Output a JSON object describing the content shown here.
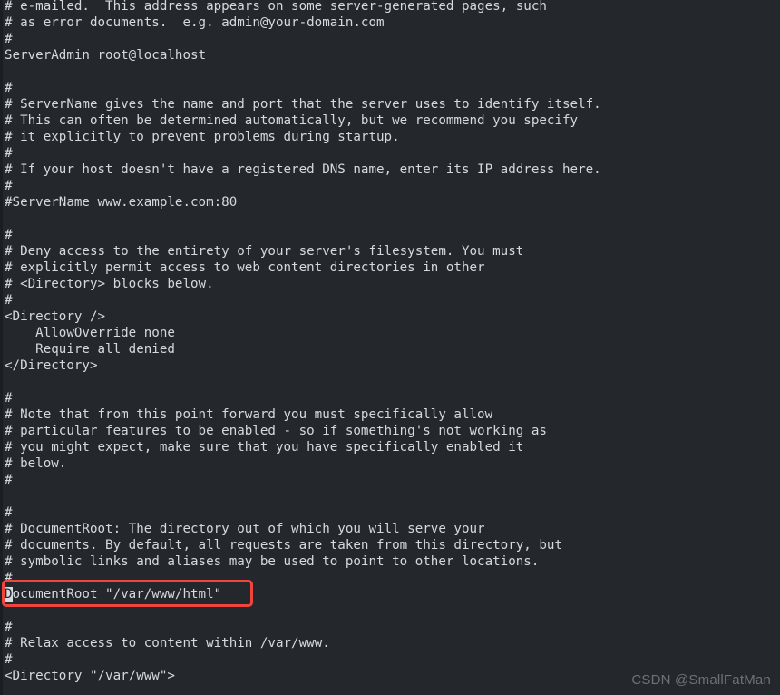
{
  "editor": {
    "background_color": "#24282c",
    "text_color": "#d6d9dc",
    "highlight_color": "#f0453c",
    "cursor_char": "D",
    "lines": [
      "# e-mailed.  This address appears on some server-generated pages, such",
      "# as error documents.  e.g. admin@your-domain.com",
      "#",
      "ServerAdmin root@localhost",
      "",
      "#",
      "# ServerName gives the name and port that the server uses to identify itself.",
      "# This can often be determined automatically, but we recommend you specify",
      "# it explicitly to prevent problems during startup.",
      "#",
      "# If your host doesn't have a registered DNS name, enter its IP address here.",
      "#",
      "#ServerName www.example.com:80",
      "",
      "#",
      "# Deny access to the entirety of your server's filesystem. You must",
      "# explicitly permit access to web content directories in other",
      "# <Directory> blocks below.",
      "#",
      "<Directory />",
      "    AllowOverride none",
      "    Require all denied",
      "</Directory>",
      "",
      "#",
      "# Note that from this point forward you must specifically allow",
      "# particular features to be enabled - so if something's not working as",
      "# you might expect, make sure that you have specifically enabled it",
      "# below.",
      "#",
      "",
      "#",
      "# DocumentRoot: The directory out of which you will serve your",
      "# documents. By default, all requests are taken from this directory, but",
      "# symbolic links and aliases may be used to point to other locations.",
      "#",
      "DocumentRoot \"/var/www/html\"",
      "",
      "#",
      "# Relax access to content within /var/www.",
      "#",
      "<Directory \"/var/www\">"
    ],
    "highlighted_line_index": 36,
    "highlighted_line_text": "DocumentRoot \"/var/www/html\""
  },
  "watermark": {
    "text": "CSDN @SmallFatMan"
  }
}
